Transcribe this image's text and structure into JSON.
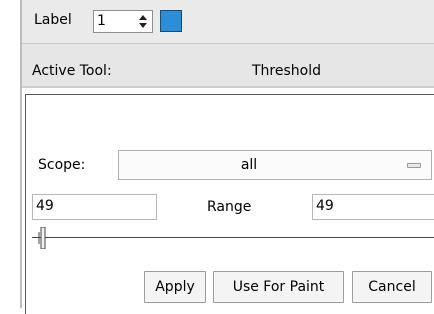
{
  "label_bar": {
    "label": "Label",
    "spin_value": "1",
    "swatch_color": "#2b8fd8"
  },
  "tool_bar": {
    "caption": "Active Tool:",
    "tool_name": "Threshold"
  },
  "threshold": {
    "scope_label": "Scope:",
    "scope_value": "all",
    "range_label": "Range",
    "min_value": "49",
    "max_value": "49",
    "buttons": {
      "apply": "Apply",
      "use_for_paint": "Use For Paint",
      "cancel": "Cancel"
    }
  }
}
